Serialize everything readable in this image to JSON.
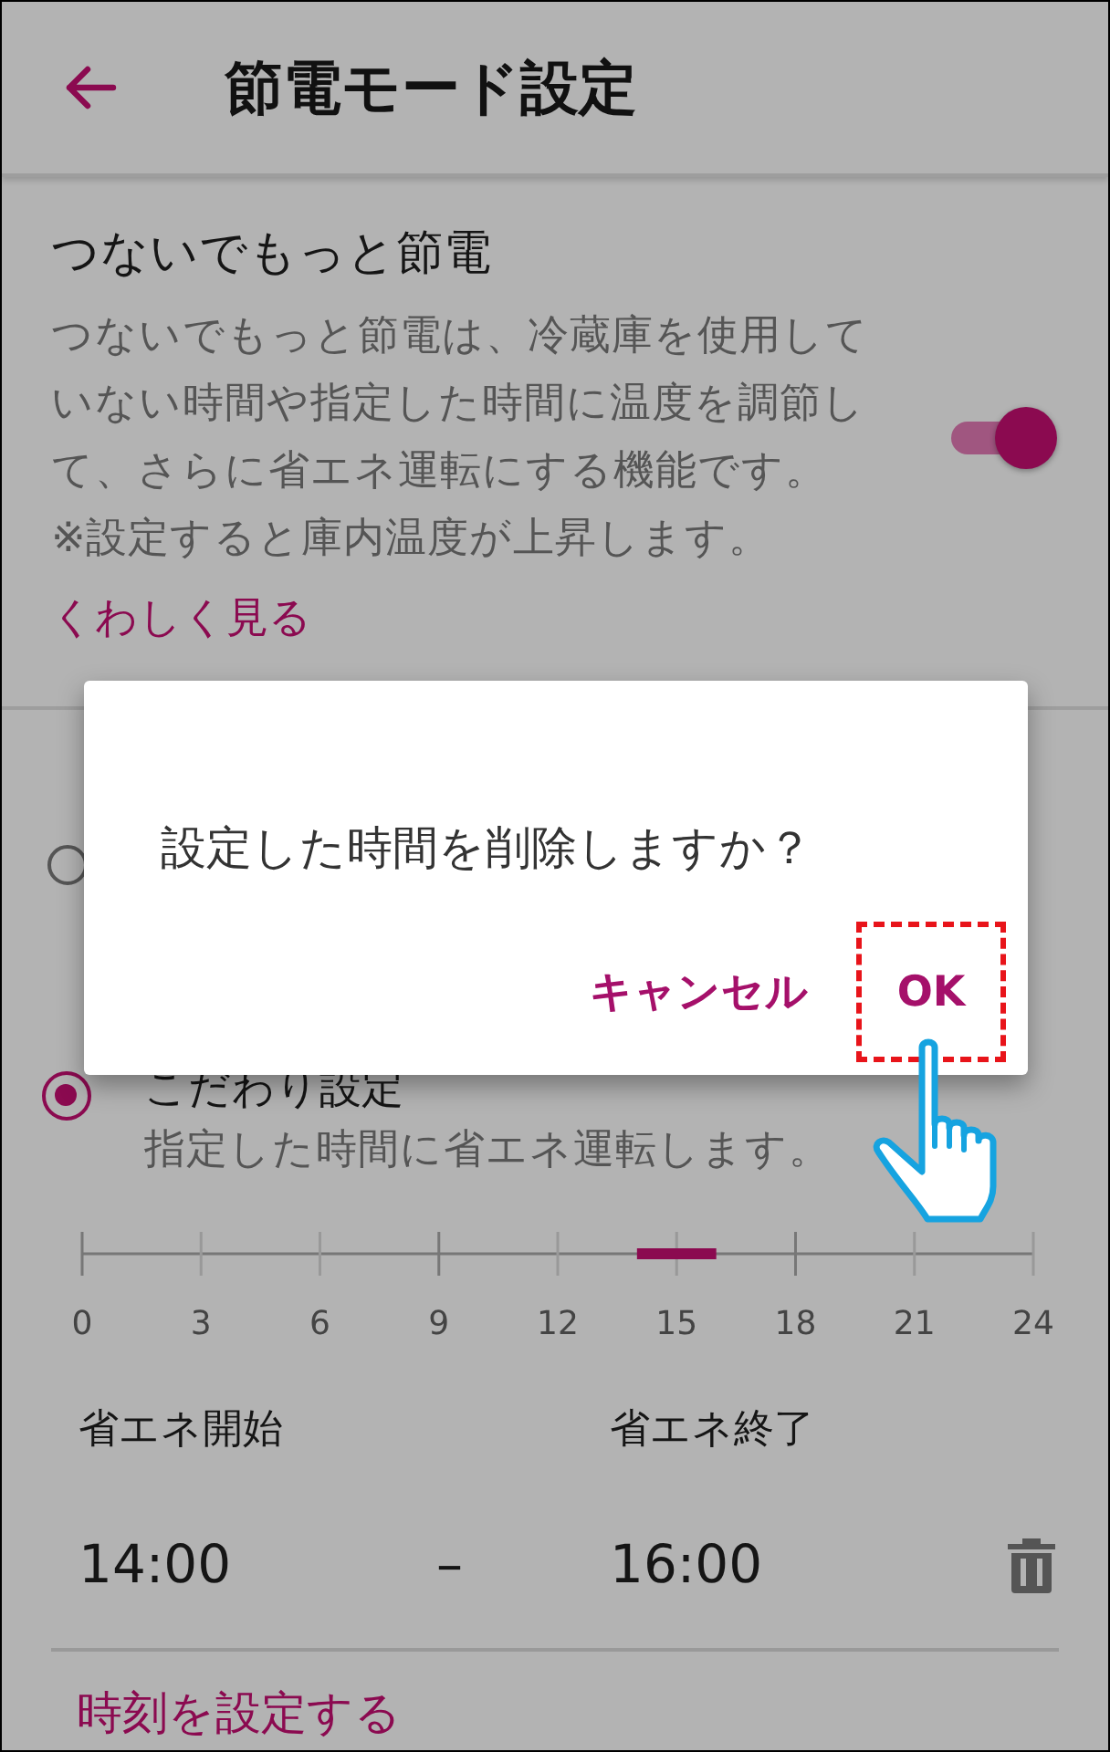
{
  "app_bar": {
    "title": "節電モード設定"
  },
  "eco_setting": {
    "title": "つないでもっと節電",
    "description": "つないでもっと節電は、冷蔵庫を使用していない時間や指定した時間に温度を調節して、さらに省エネ運転にする機能です。",
    "note": "※設定すると庫内温度が上昇します。",
    "toggle": {
      "on": true
    },
    "link": "くわしく見る"
  },
  "modes": [
    {
      "selected": false
    },
    {
      "label": "こだわり設定",
      "description": "指定した時間に省エネ運転します。",
      "selected": true
    }
  ],
  "schedule": {
    "timeline_ticks": [
      "0",
      "3",
      "6",
      "9",
      "12",
      "15",
      "18",
      "21",
      "24"
    ],
    "start_label": "省エネ開始",
    "end_label": "省エネ終了",
    "start_time": "14:00",
    "separator": "–",
    "end_time": "16:00",
    "add_link": "時刻を設定する"
  },
  "dialog": {
    "message": "設定した時間を削除しますか？",
    "buttons": [
      {
        "label": "キャンセル",
        "highlighted": false
      },
      {
        "label": "OK",
        "highlighted": true
      }
    ]
  }
}
